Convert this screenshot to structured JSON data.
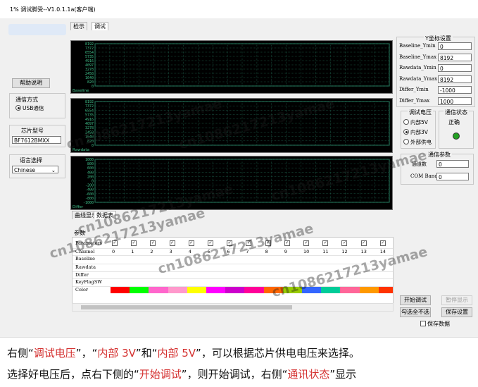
{
  "window": {
    "title": "1% 调试脚受--V1.0.1.1a(客户端)"
  },
  "tabs": [
    {
      "label": "检示"
    },
    {
      "label": "调试"
    }
  ],
  "left_panel": {
    "help_button": "帮助说明",
    "comm_mode": {
      "label": "通信方式",
      "option": "USB通信"
    },
    "chip_model": {
      "label": "芯片型号",
      "value": "BF7612BMXX"
    },
    "language": {
      "label": "语言选择",
      "value": "Chinese"
    }
  },
  "charts": [
    {
      "name": "Baseline",
      "ticks": [
        "8192",
        "7372",
        "6554",
        "5735",
        "4916",
        "4097",
        "3278",
        "2458",
        "1640",
        "820",
        "0"
      ]
    },
    {
      "name": "Rawdata",
      "ticks": [
        "8192",
        "7372",
        "6554",
        "5735",
        "4916",
        "4097",
        "3278",
        "2458",
        "1640",
        "820",
        "0"
      ]
    },
    {
      "name": "Differ",
      "ticks": [
        "1000",
        "800",
        "600",
        "400",
        "200",
        "0",
        "-200",
        "-400",
        "-600",
        "-800",
        "-1000"
      ]
    }
  ],
  "y_axis_settings": {
    "title": "Y坐标设置",
    "fields": [
      {
        "label": "Baseline_Ymin",
        "value": "0"
      },
      {
        "label": "Baseline_Ymax",
        "value": "8192"
      },
      {
        "label": "Rawdata_Ymin",
        "value": "0"
      },
      {
        "label": "Rawdata_Ymax",
        "value": "8192"
      },
      {
        "label": "Differ_Ymin",
        "value": "-1000"
      },
      {
        "label": "Differ_Ymax",
        "value": "1000"
      }
    ]
  },
  "voltage": {
    "title": "调试电压",
    "options": [
      "内部5V",
      "内部3V",
      "外部供电"
    ]
  },
  "comm_status": {
    "title": "通信状态",
    "value": "正确",
    "led_color": "#22a022"
  },
  "comm_params": {
    "title": "通信参数",
    "fields": [
      {
        "label": "通道数",
        "value": "0"
      },
      {
        "label": "COM Band",
        "value": "0"
      }
    ]
  },
  "table": {
    "bottom_tabs": [
      "曲线显示",
      "数据表"
    ],
    "section_label": "参数",
    "row_labels": [
      "Parameters",
      "Channel",
      "Baseline",
      "Rawdata",
      "Differ",
      "KeyFlagSW",
      "Color"
    ],
    "channels": [
      "0",
      "1",
      "2",
      "3",
      "4",
      "5",
      "6",
      "7",
      "8",
      "9",
      "10",
      "11",
      "12",
      "13",
      "14"
    ],
    "colors": [
      "#ff0000",
      "#00ff00",
      "#ff66cc",
      "#ff99cc",
      "#ffff00",
      "#ff00ff",
      "#cc00cc",
      "#ff0099",
      "#ff6600",
      "#99cc00",
      "#3366ff",
      "#00cc99",
      "#ff6699",
      "#ff9900",
      "#ff3300"
    ]
  },
  "buttons": {
    "start": "开始调试",
    "pause": "暂停显示",
    "select_all": "勾选全不选",
    "save_settings": "保存设置",
    "save_data": "保存数据"
  },
  "watermark": "cn1086217213yamae",
  "caption": {
    "line1": [
      {
        "text": "右侧“",
        "red": false
      },
      {
        "text": "调试电压",
        "red": true
      },
      {
        "text": "”，“",
        "red": false
      },
      {
        "text": "内部 3V",
        "red": true
      },
      {
        "text": "”和“",
        "red": false
      },
      {
        "text": "内部 5V",
        "red": true
      },
      {
        "text": "”，可以根据芯片供电电压来选择。",
        "red": false
      }
    ],
    "line2": [
      {
        "text": "选择好电压后，点右下侧的“",
        "red": false
      },
      {
        "text": "开始调试",
        "red": true
      },
      {
        "text": "”，则开始调试，右侧“",
        "red": false
      },
      {
        "text": "通讯状态",
        "red": true
      },
      {
        "text": "”显示",
        "red": false
      }
    ]
  }
}
